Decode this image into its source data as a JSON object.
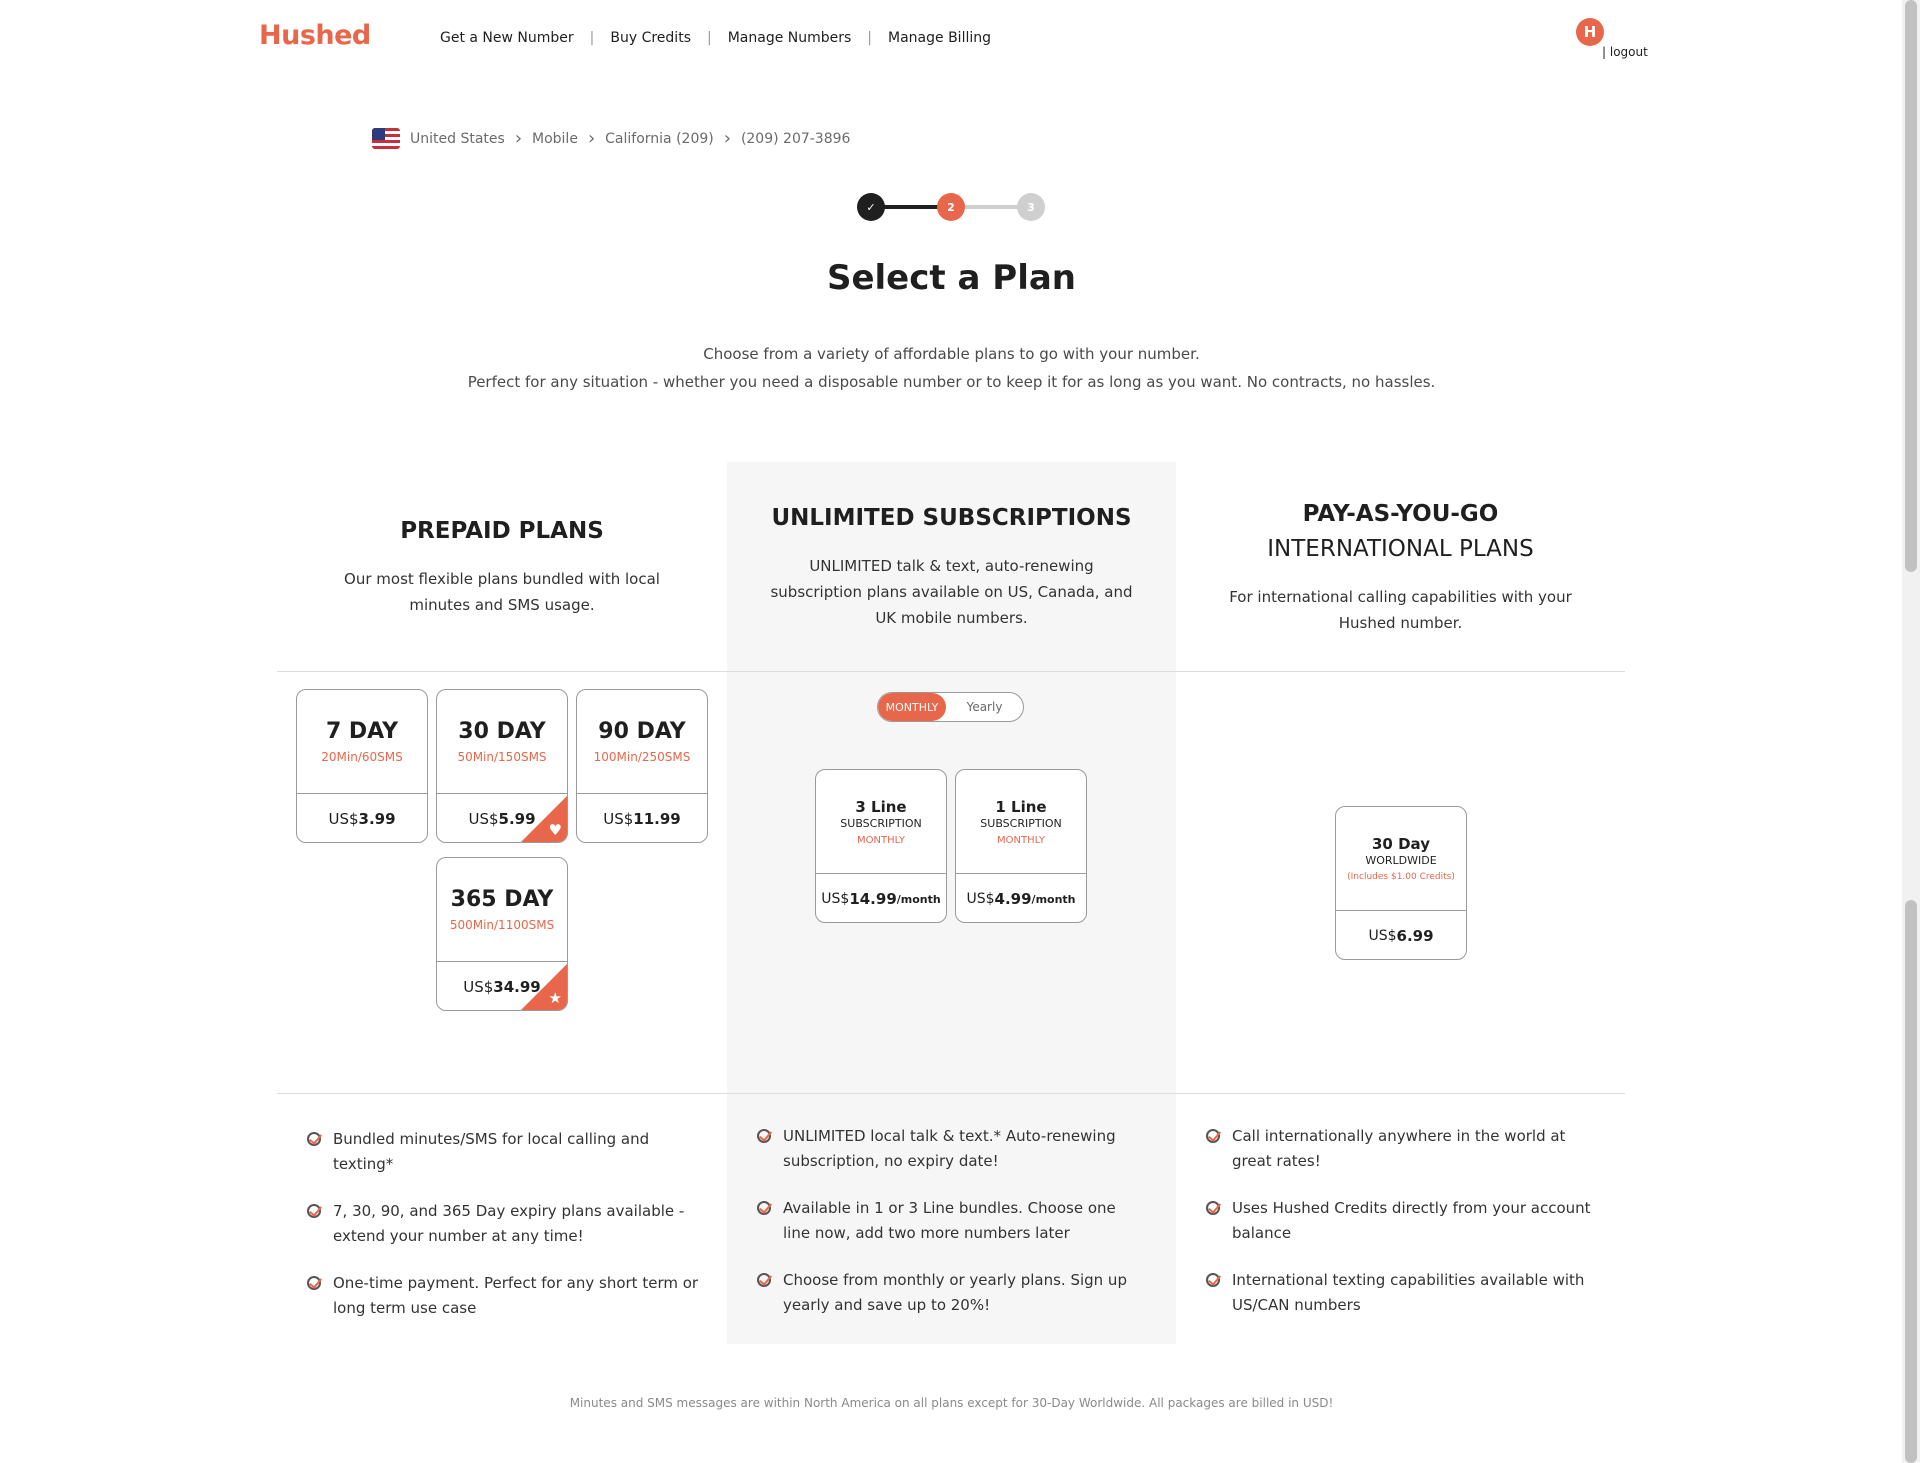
{
  "header": {
    "logo": "Hushed",
    "nav": [
      "Get a New Number",
      "Buy Credits",
      "Manage Numbers",
      "Manage Billing"
    ],
    "nav_separator": "|",
    "avatar_initial": "H",
    "logout": "| logout"
  },
  "breadcrumb": {
    "items": [
      "United States",
      "Mobile",
      "California (209)",
      "(209) 207-3896"
    ],
    "separator": ">"
  },
  "stepper": {
    "step1_icon": "check-icon",
    "step2": "2",
    "step3": "3",
    "current_step": 2
  },
  "title": "Select a Plan",
  "intro": {
    "line1": "Choose from a variety of affordable plans to go with your number.",
    "line2": "Perfect for any situation - whether you need a disposable number or to keep it for as long as you want. No contracts, no hassles."
  },
  "prepaid": {
    "title": "PREPAID PLANS",
    "desc": "Our most flexible plans bundled with local minutes and SMS usage.",
    "plans": [
      {
        "name": "7 DAY",
        "usage": "20Min/60SMS",
        "currency": "US$",
        "price": "3.99"
      },
      {
        "name": "30 DAY",
        "usage": "50Min/150SMS",
        "currency": "US$",
        "price": "5.99",
        "badge": "heart-icon"
      },
      {
        "name": "90 DAY",
        "usage": "100Min/250SMS",
        "currency": "US$",
        "price": "11.99"
      },
      {
        "name": "365 DAY",
        "usage": "500Min/1100SMS",
        "currency": "US$",
        "price": "34.99",
        "badge": "star-icon"
      }
    ],
    "features": [
      "Bundled minutes/SMS for local calling and texting*",
      "7, 30, 90, and 365 Day expiry plans available - extend your number at any time!",
      "One-time payment. Perfect for any short term or long term use case"
    ]
  },
  "unlimited": {
    "title": "UNLIMITED SUBSCRIPTIONS",
    "desc": "UNLIMITED talk & text, auto-renewing subscription plans available on US, Canada, and UK mobile numbers.",
    "toggle": {
      "monthly": "MONTHLY",
      "yearly": "Yearly",
      "selected": "monthly"
    },
    "plans": [
      {
        "name": "3 Line",
        "line2": "SUBSCRIPTION",
        "period": "MONTHLY",
        "currency": "US$",
        "price": "14.99",
        "suffix": " /month"
      },
      {
        "name": "1 Line",
        "line2": "SUBSCRIPTION",
        "period": "MONTHLY",
        "currency": "US$",
        "price": "4.99",
        "suffix": " /month"
      }
    ],
    "features": [
      "UNLIMITED local talk & text.* Auto-renewing subscription, no expiry date!",
      "Available in 1 or 3 Line bundles. Choose one line now, add two more numbers later",
      "Choose from monthly or yearly plans. Sign up yearly and save up to 20%!"
    ]
  },
  "payg": {
    "title1": "PAY-AS-YOU-GO",
    "title2": "INTERNATIONAL PLANS",
    "desc": "For international calling capabilities with your Hushed number.",
    "plans": [
      {
        "name": "30 Day",
        "line2": "WORLDWIDE",
        "period": "(Includes $1.00 Credits)",
        "currency": "US$",
        "price": "6.99"
      }
    ],
    "features": [
      "Call internationally anywhere in the world at great rates!",
      "Uses Hushed Credits directly from your account balance",
      "International texting capabilities available with US/CAN numbers"
    ]
  },
  "footnote": "Minutes and SMS messages are within North America on all plans except for 30-Day Worldwide. All packages are billed in USD!",
  "colors": {
    "accent": "#e8674a",
    "text": "#1f1f1f",
    "panel": "#f6f6f6"
  }
}
